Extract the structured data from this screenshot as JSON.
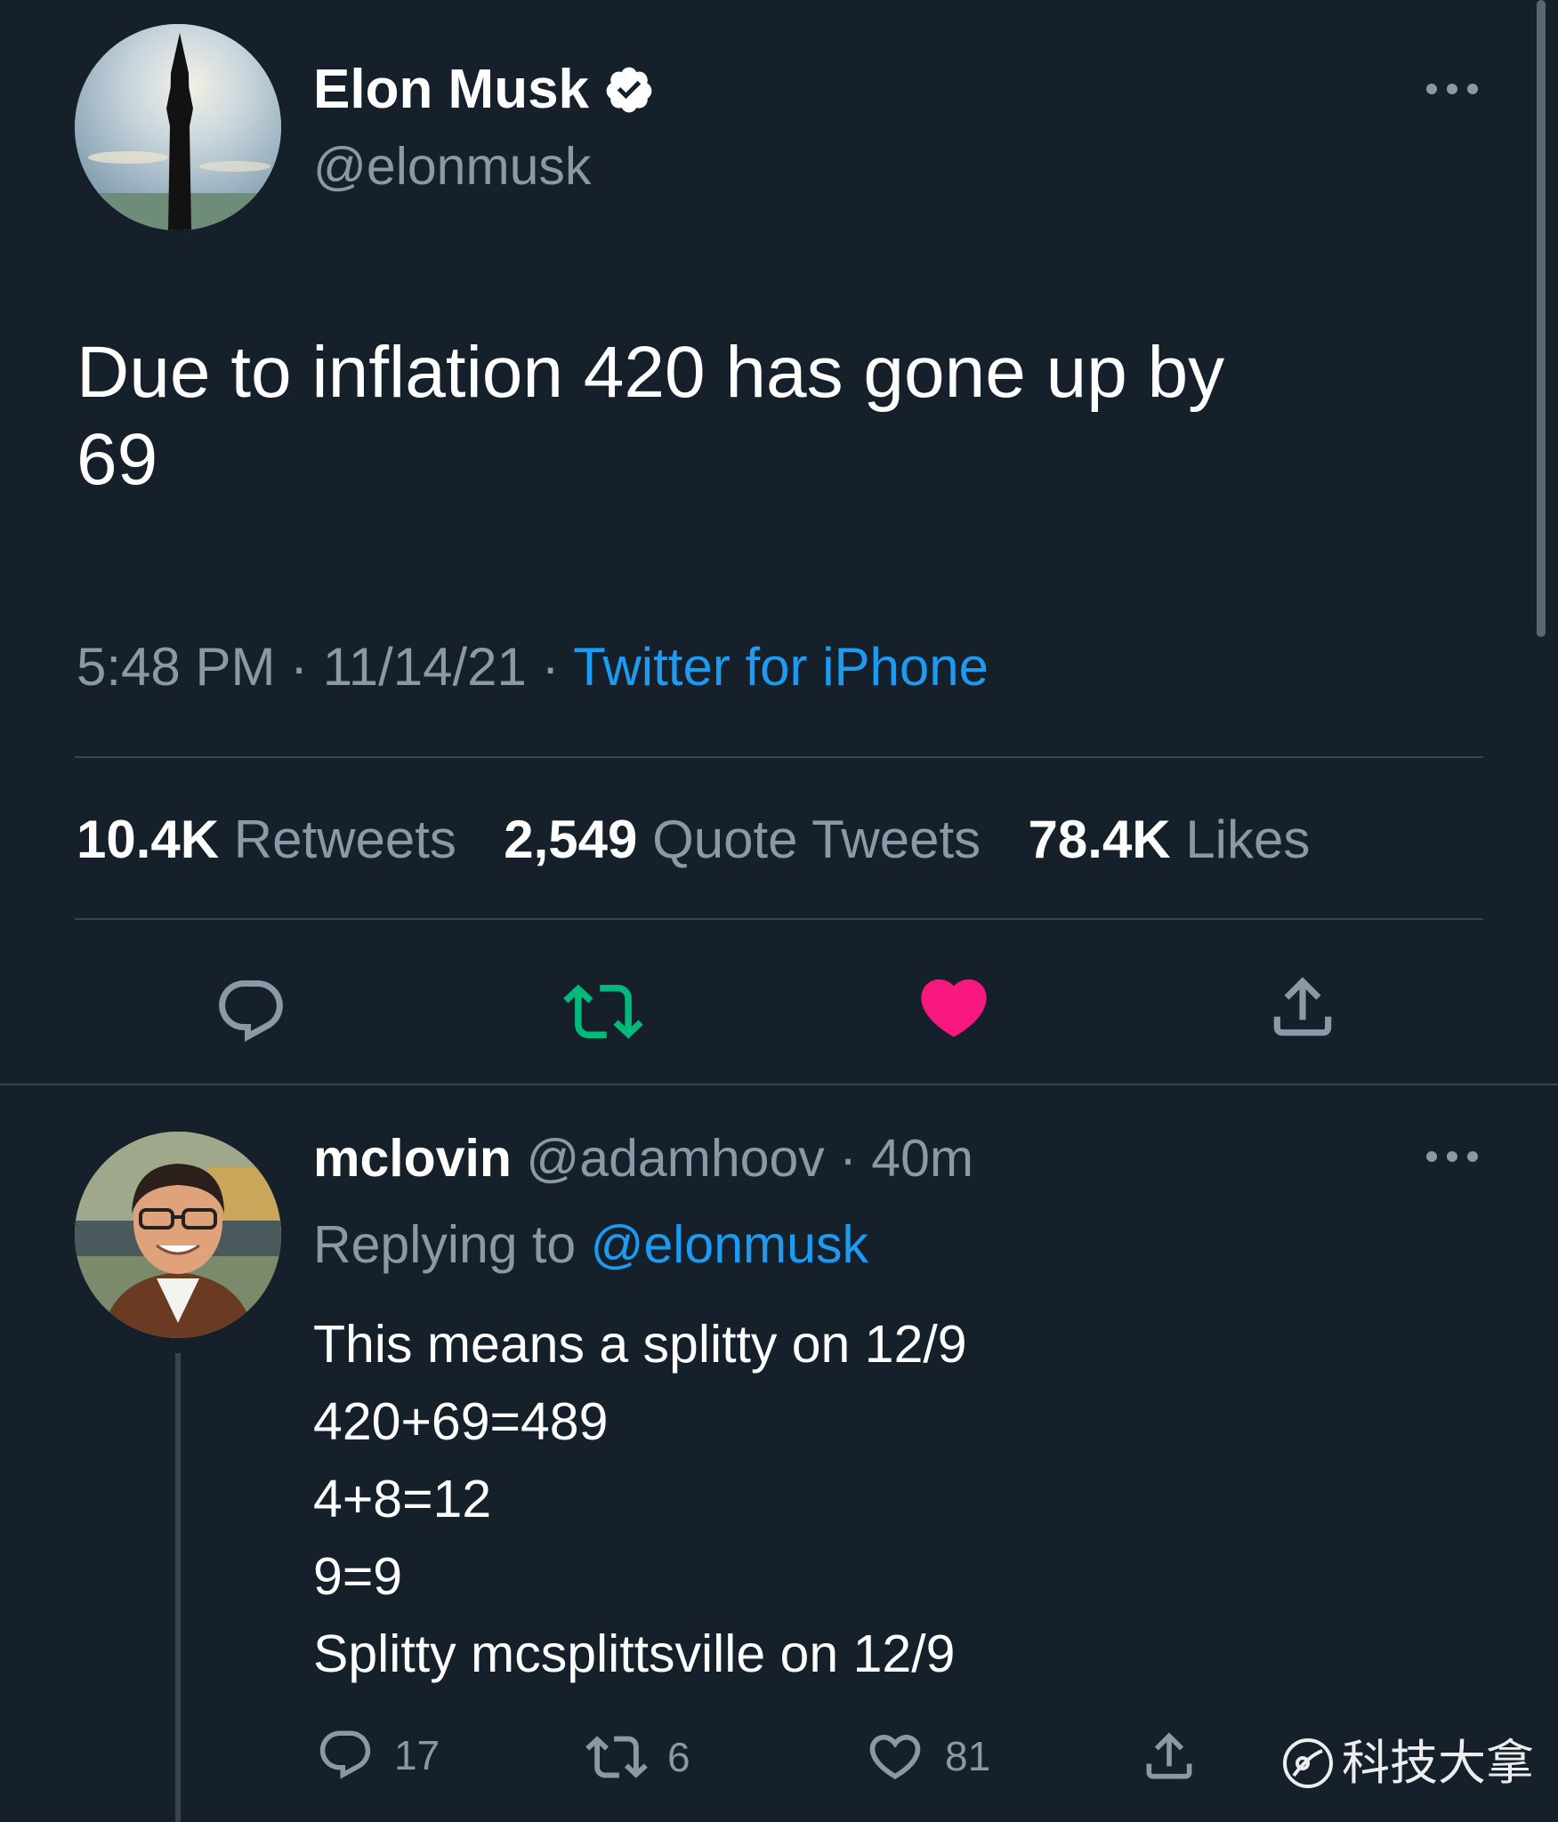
{
  "main_tweet": {
    "author": {
      "name": "Elon Musk",
      "handle": "@elonmusk",
      "verified": true
    },
    "text": "Due to inflation 420 has gone up by\n69",
    "time": "5:48 PM",
    "date": "11/14/21",
    "separator": "·",
    "source": "Twitter for iPhone",
    "stats": {
      "retweets_count": "10.4K",
      "retweets_label": "Retweets",
      "quotes_count": "2,549",
      "quotes_label": "Quote Tweets",
      "likes_count": "78.4K",
      "likes_label": "Likes"
    },
    "actions": [
      "reply-icon",
      "retweet-icon",
      "heart-icon",
      "share-icon"
    ]
  },
  "reply": {
    "author": {
      "name": "mclovin",
      "handle": "@adamhoov",
      "time": "40m"
    },
    "separator": "·",
    "replying_to_label": "Replying to",
    "replying_to_handle": "@elonmusk",
    "text": "This means a splitty on 12/9\n420+69=489\n4+8=12\n9=9\nSplitty mcsplittsville on 12/9",
    "counts": {
      "replies": "17",
      "retweets": "6",
      "likes": "81"
    }
  },
  "watermark": {
    "text": "科技大拿"
  },
  "colors": {
    "background": "#15202b",
    "link": "#1d9bf0",
    "secondary_text": "#8b98a5",
    "retweet_active": "#00ba7c",
    "like_active": "#f91880"
  }
}
